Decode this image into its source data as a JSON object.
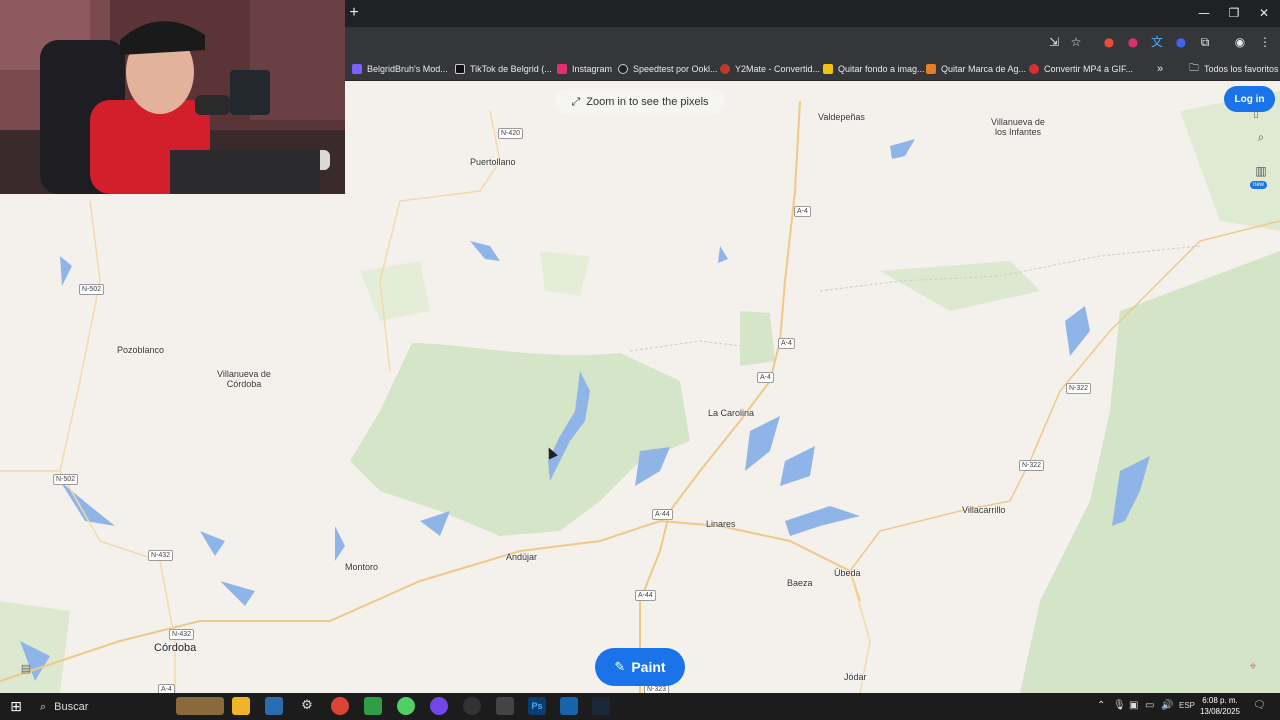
{
  "browser": {
    "new_tab_label": "+",
    "window_controls": {
      "minimize": "—",
      "restore": "❐",
      "close": "✕"
    },
    "bookmarks": [
      {
        "label": "BelgridBruh's Mod...",
        "color": "#7b61ff"
      },
      {
        "label": "TikTok de Belgrid (...",
        "color": "#111111"
      },
      {
        "label": "Instagram",
        "color": "#e1306c"
      },
      {
        "label": "Speedtest por Ookl...",
        "color": "#222222"
      },
      {
        "label": "Y2Mate - Convertid...",
        "color": "#c0392b"
      },
      {
        "label": "Quitar fondo a imag...",
        "color": "#f1c40f"
      },
      {
        "label": "Quitar Marca de Ag...",
        "color": "#e67e22"
      },
      {
        "label": "Convertir MP4 a GIF...",
        "color": "#d63031"
      }
    ],
    "bookmarks_overflow": "»",
    "all_bookmarks_label": "Todos los favoritos"
  },
  "map": {
    "zoom_hint": "Zoom in to see the pixels",
    "login_label": "Log in",
    "new_badge": "new",
    "paint_label": "Paint",
    "places": [
      {
        "name": "Valdepeñas",
        "big": false
      },
      {
        "name": "Villanueva de los Infantes",
        "big": false
      },
      {
        "name": "Puertollano",
        "big": false
      },
      {
        "name": "Pozoblanco",
        "big": false
      },
      {
        "name": "Villanueva de Córdoba",
        "big": false
      },
      {
        "name": "La Carolina",
        "big": false
      },
      {
        "name": "Villacarrillo",
        "big": false
      },
      {
        "name": "Linares",
        "big": false
      },
      {
        "name": "Andújar",
        "big": false
      },
      {
        "name": "Montoro",
        "big": false
      },
      {
        "name": "Baeza",
        "big": false
      },
      {
        "name": "Úbeda",
        "big": false
      },
      {
        "name": "Córdoba",
        "big": true
      },
      {
        "name": "Jódar",
        "big": false
      }
    ],
    "roads": [
      "N-420",
      "A-4",
      "A-4",
      "A-4",
      "N-502",
      "N-502",
      "N-322",
      "N-322",
      "A-44",
      "A-44",
      "N-432",
      "N-432",
      "A-4",
      "N-323"
    ]
  },
  "taskbar": {
    "search_label": "Buscar",
    "language": "ESP",
    "time": "6:08 p. m.",
    "date": "13/08/2025"
  }
}
